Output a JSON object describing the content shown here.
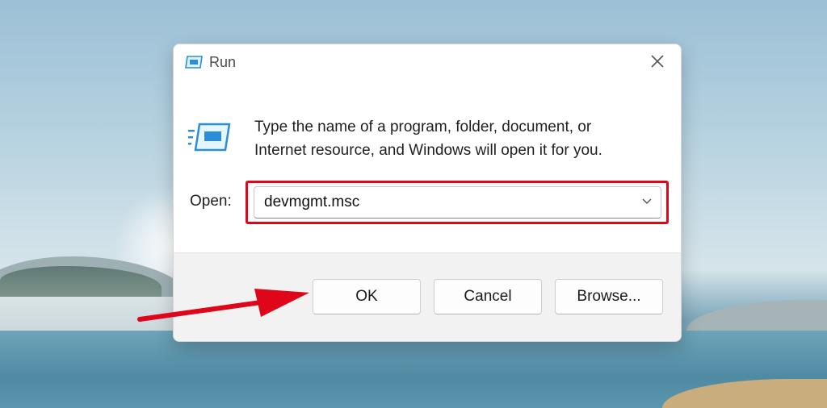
{
  "dialog": {
    "title": "Run",
    "title_icon": "run-icon",
    "close_icon": "close-icon",
    "app_icon": "run-program-icon",
    "description_line1": "Type the name of a program, folder, document, or",
    "description_line2": "Internet resource, and Windows will open it for you.",
    "open_label": "Open:",
    "open_value": "devmgmt.msc",
    "dropdown_icon": "chevron-down-icon",
    "buttons": {
      "ok": "OK",
      "cancel": "Cancel",
      "browse": "Browse..."
    }
  },
  "annotation": {
    "highlight_color": "#e0061a",
    "arrow_color": "#e0061a"
  }
}
